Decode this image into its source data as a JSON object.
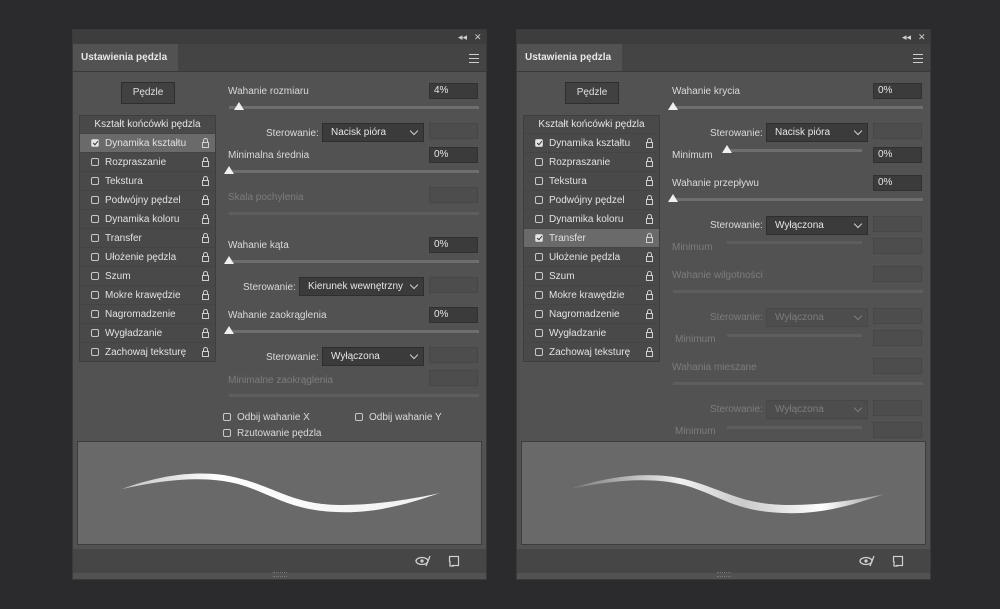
{
  "panel1": {
    "tab_title": "Ustawienia pędzla",
    "brushes_button": "Pędzle",
    "list_header": "Kształt końcówki pędzla",
    "items": [
      {
        "label": "Dynamika kształtu",
        "checked": true,
        "selected": true
      },
      {
        "label": "Rozpraszanie",
        "checked": false,
        "selected": false
      },
      {
        "label": "Tekstura",
        "checked": false,
        "selected": false
      },
      {
        "label": "Podwójny pędzel",
        "checked": false,
        "selected": false
      },
      {
        "label": "Dynamika koloru",
        "checked": false,
        "selected": false
      },
      {
        "label": "Transfer",
        "checked": false,
        "selected": false
      },
      {
        "label": "Ułożenie pędzla",
        "checked": false,
        "selected": false
      },
      {
        "label": "Szum",
        "checked": false,
        "selected": false
      },
      {
        "label": "Mokre krawędzie",
        "checked": false,
        "selected": false
      },
      {
        "label": "Nagromadzenie",
        "checked": false,
        "selected": false
      },
      {
        "label": "Wygładzanie",
        "checked": false,
        "selected": false
      },
      {
        "label": "Zachowaj teksturę",
        "checked": false,
        "selected": false
      }
    ],
    "size_jitter_label": "Wahanie rozmiaru",
    "size_jitter_value": "4%",
    "control_label": "Sterowanie:",
    "control1_value": "Nacisk pióra",
    "min_diameter_label": "Minimalna średnia",
    "min_diameter_value": "0%",
    "tilt_scale_label": "Skala pochylenia",
    "angle_jitter_label": "Wahanie kąta",
    "angle_jitter_value": "0%",
    "control2_value": "Kierunek wewnętrzny",
    "roundness_jitter_label": "Wahanie zaokrąglenia",
    "roundness_jitter_value": "0%",
    "control3_value": "Wyłączona",
    "min_roundness_label": "Minimalne zaokrąglenia",
    "flip_x_label": "Odbij wahanie X",
    "flip_y_label": "Odbij wahanie Y",
    "projection_label": "Rzutowanie pędzla",
    "topbar_collapse": "◂◂",
    "topbar_close": "✕"
  },
  "panel2": {
    "tab_title": "Ustawienia pędzla",
    "brushes_button": "Pędzle",
    "list_header": "Kształt końcówki pędzla",
    "items": [
      {
        "label": "Dynamika kształtu",
        "checked": true,
        "selected": false
      },
      {
        "label": "Rozpraszanie",
        "checked": false,
        "selected": false
      },
      {
        "label": "Tekstura",
        "checked": false,
        "selected": false
      },
      {
        "label": "Podwójny pędzel",
        "checked": false,
        "selected": false
      },
      {
        "label": "Dynamika koloru",
        "checked": false,
        "selected": false
      },
      {
        "label": "Transfer",
        "checked": true,
        "selected": true
      },
      {
        "label": "Ułożenie pędzla",
        "checked": false,
        "selected": false
      },
      {
        "label": "Szum",
        "checked": false,
        "selected": false
      },
      {
        "label": "Mokre krawędzie",
        "checked": false,
        "selected": false
      },
      {
        "label": "Nagromadzenie",
        "checked": false,
        "selected": false
      },
      {
        "label": "Wygładzanie",
        "checked": false,
        "selected": false
      },
      {
        "label": "Zachowaj teksturę",
        "checked": false,
        "selected": false
      }
    ],
    "opacity_jitter_label": "Wahanie krycia",
    "opacity_jitter_value": "0%",
    "control_label": "Sterowanie:",
    "control1_value": "Nacisk pióra",
    "minimum_label": "Minimum",
    "minimum1_value": "0%",
    "flow_jitter_label": "Wahanie przepływu",
    "flow_jitter_value": "0%",
    "control2_value": "Wyłączona",
    "wetness_jitter_label": "Wahanie wilgotności",
    "control3_value": "Wyłączona",
    "mix_jitter_label": "Wahania mieszane",
    "control4_value": "Wyłączona",
    "topbar_collapse": "◂◂",
    "topbar_close": "✕"
  },
  "colors": {
    "background": "#2b2a2c",
    "panel": "#535253",
    "field": "#3c3b3c",
    "preview": "#6a696a"
  }
}
